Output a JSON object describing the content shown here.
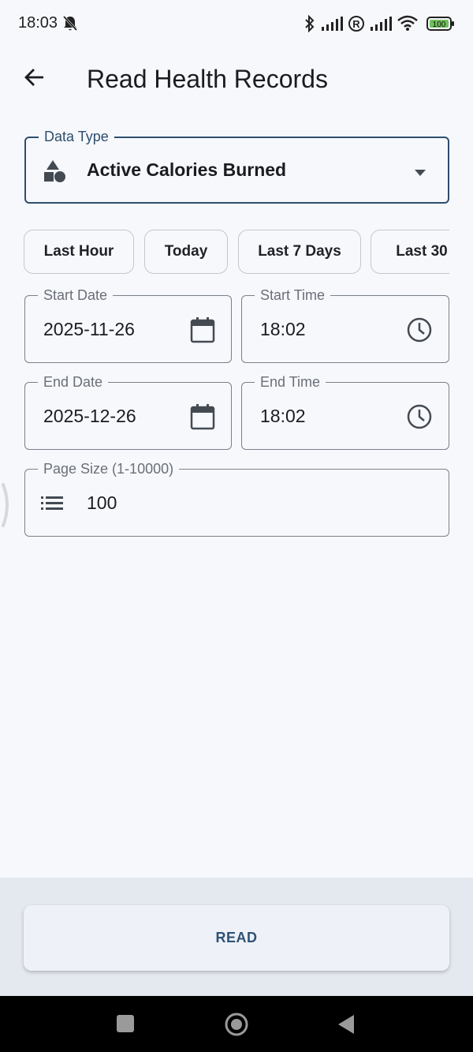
{
  "status_bar": {
    "time": "18:03",
    "battery": "100",
    "icons": [
      "bell-off-icon",
      "bluetooth-icon",
      "signal-icon",
      "registered-icon",
      "signal-icon",
      "wifi-icon",
      "battery-icon"
    ]
  },
  "app_bar": {
    "back_icon": "arrow-back-icon",
    "title": "Read Health Records"
  },
  "data_type": {
    "label": "Data Type",
    "value": "Active Calories Burned",
    "icon": "shapes-icon"
  },
  "range_chips": [
    "Last Hour",
    "Today",
    "Last 7 Days",
    "Last 30"
  ],
  "start_date": {
    "label": "Start Date",
    "value": "2025-11-26"
  },
  "start_time": {
    "label": "Start Time",
    "value": "18:02"
  },
  "end_date": {
    "label": "End Date",
    "value": "2025-12-26"
  },
  "end_time": {
    "label": "End Time",
    "value": "18:02"
  },
  "page_size": {
    "label": "Page Size (1-10000)",
    "value": "100"
  },
  "read_button": {
    "label": "READ"
  },
  "colors": {
    "accent": "#2d4e6e",
    "background": "#f7f8fc",
    "button_text": "#2f5275"
  }
}
